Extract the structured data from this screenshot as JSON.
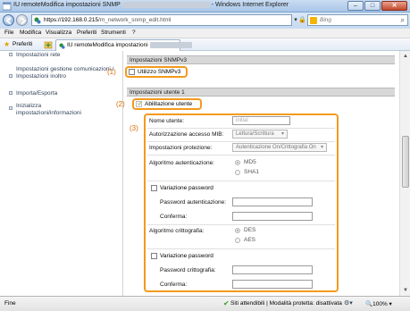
{
  "window": {
    "title": "IU remoteModifica impostazioni SNMP - Windows Internet Explorer",
    "title_prefix": "IU remoteModifica impostazioni SNMP",
    "title_suffix": "- Windows Internet Explorer",
    "min_symbol": "–",
    "max_symbol": "□",
    "close_symbol": "✕"
  },
  "address": {
    "host": "https://192.168.0.215",
    "path": "/m_network_snmp_edit.html",
    "search_placeholder": "Bing",
    "search_icon": "magnifier-icon"
  },
  "menu": [
    "File",
    "Modifica",
    "Visualizza",
    "Preferiti",
    "Strumenti",
    "?"
  ],
  "favorites": {
    "label": "Preferiti",
    "tab_label": "IU remoteModifica impostazioni"
  },
  "sidebar": {
    "items": [
      {
        "label": "Impostazioni rete"
      },
      {
        "label": "Impostazioni gestione comunicazioni / Impostazioni inoltro"
      },
      {
        "label": "Importa/Esporta"
      },
      {
        "label": "Inizializza impostazioni/informazioni"
      }
    ]
  },
  "snmpv3": {
    "header": "Impostazioni SNMPv3",
    "use_label": "Utilizzo SNMPv3"
  },
  "user1": {
    "header": "Impostazioni utente 1",
    "enable_label": "Abilitazione utente",
    "username_label": "Nome utente:",
    "username_placeholder": "initial",
    "mib_label": "Autorizzazione accesso MIB:",
    "mib_value": "Lettura/Scrittura",
    "security_label": "Impostazioni protezione:",
    "security_value": "Autenticazione On/Crittografia On",
    "auth_algo_label": "Algoritmo autenticazione:",
    "auth_options": [
      "MD5",
      "SHA1"
    ],
    "change_pwd_label": "Variazione password",
    "auth_pwd_label": "Password autenticazione:",
    "confirm_label": "Conferma:",
    "crypto_algo_label": "Algoritmo crittografia:",
    "crypto_options": [
      "DES",
      "AES"
    ],
    "change_pwd2_label": "Variazione password",
    "crypto_pwd_label": "Password crittografia:",
    "confirm2_label": "Conferma:"
  },
  "callouts": [
    "(1)",
    "(2)",
    "(3)"
  ],
  "status": {
    "left": "Fine",
    "zone": "Siti attendibili | Modalità protetta: disattivata",
    "zoom": "100%"
  },
  "colors": {
    "callout_orange": "#f39a1e",
    "title_bar": "#a9c6e8"
  }
}
